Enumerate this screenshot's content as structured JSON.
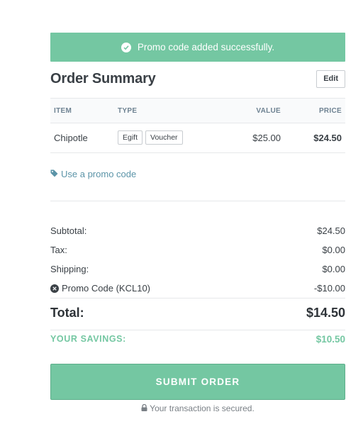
{
  "alert": {
    "message": "Promo code added successfully.",
    "icon": "check-circle-icon",
    "color": "#74c7a2"
  },
  "header": {
    "title": "Order Summary",
    "edit_label": "Edit"
  },
  "table": {
    "columns": [
      "ITEM",
      "TYPE",
      "VALUE",
      "PRICE"
    ],
    "rows": [
      {
        "item": "Chipotle",
        "types": [
          "Egift",
          "Voucher"
        ],
        "value": "$25.00",
        "price": "$24.50"
      }
    ]
  },
  "promo": {
    "link_label": "Use a promo code",
    "icon": "tag-icon"
  },
  "summary": {
    "subtotal_label": "Subtotal:",
    "subtotal_value": "$24.50",
    "tax_label": "Tax:",
    "tax_value": "$0.00",
    "shipping_label": "Shipping:",
    "shipping_value": "$0.00",
    "promo_label": "Promo Code (KCL10)",
    "promo_value": "-$10.00",
    "total_label": "Total:",
    "total_value": "$14.50",
    "savings_label": "YOUR SAVINGS:",
    "savings_value": "$10.50"
  },
  "footer": {
    "submit_label": "SUBMIT ORDER",
    "secure_text": "Your transaction is secured.",
    "secure_icon": "lock-icon"
  }
}
